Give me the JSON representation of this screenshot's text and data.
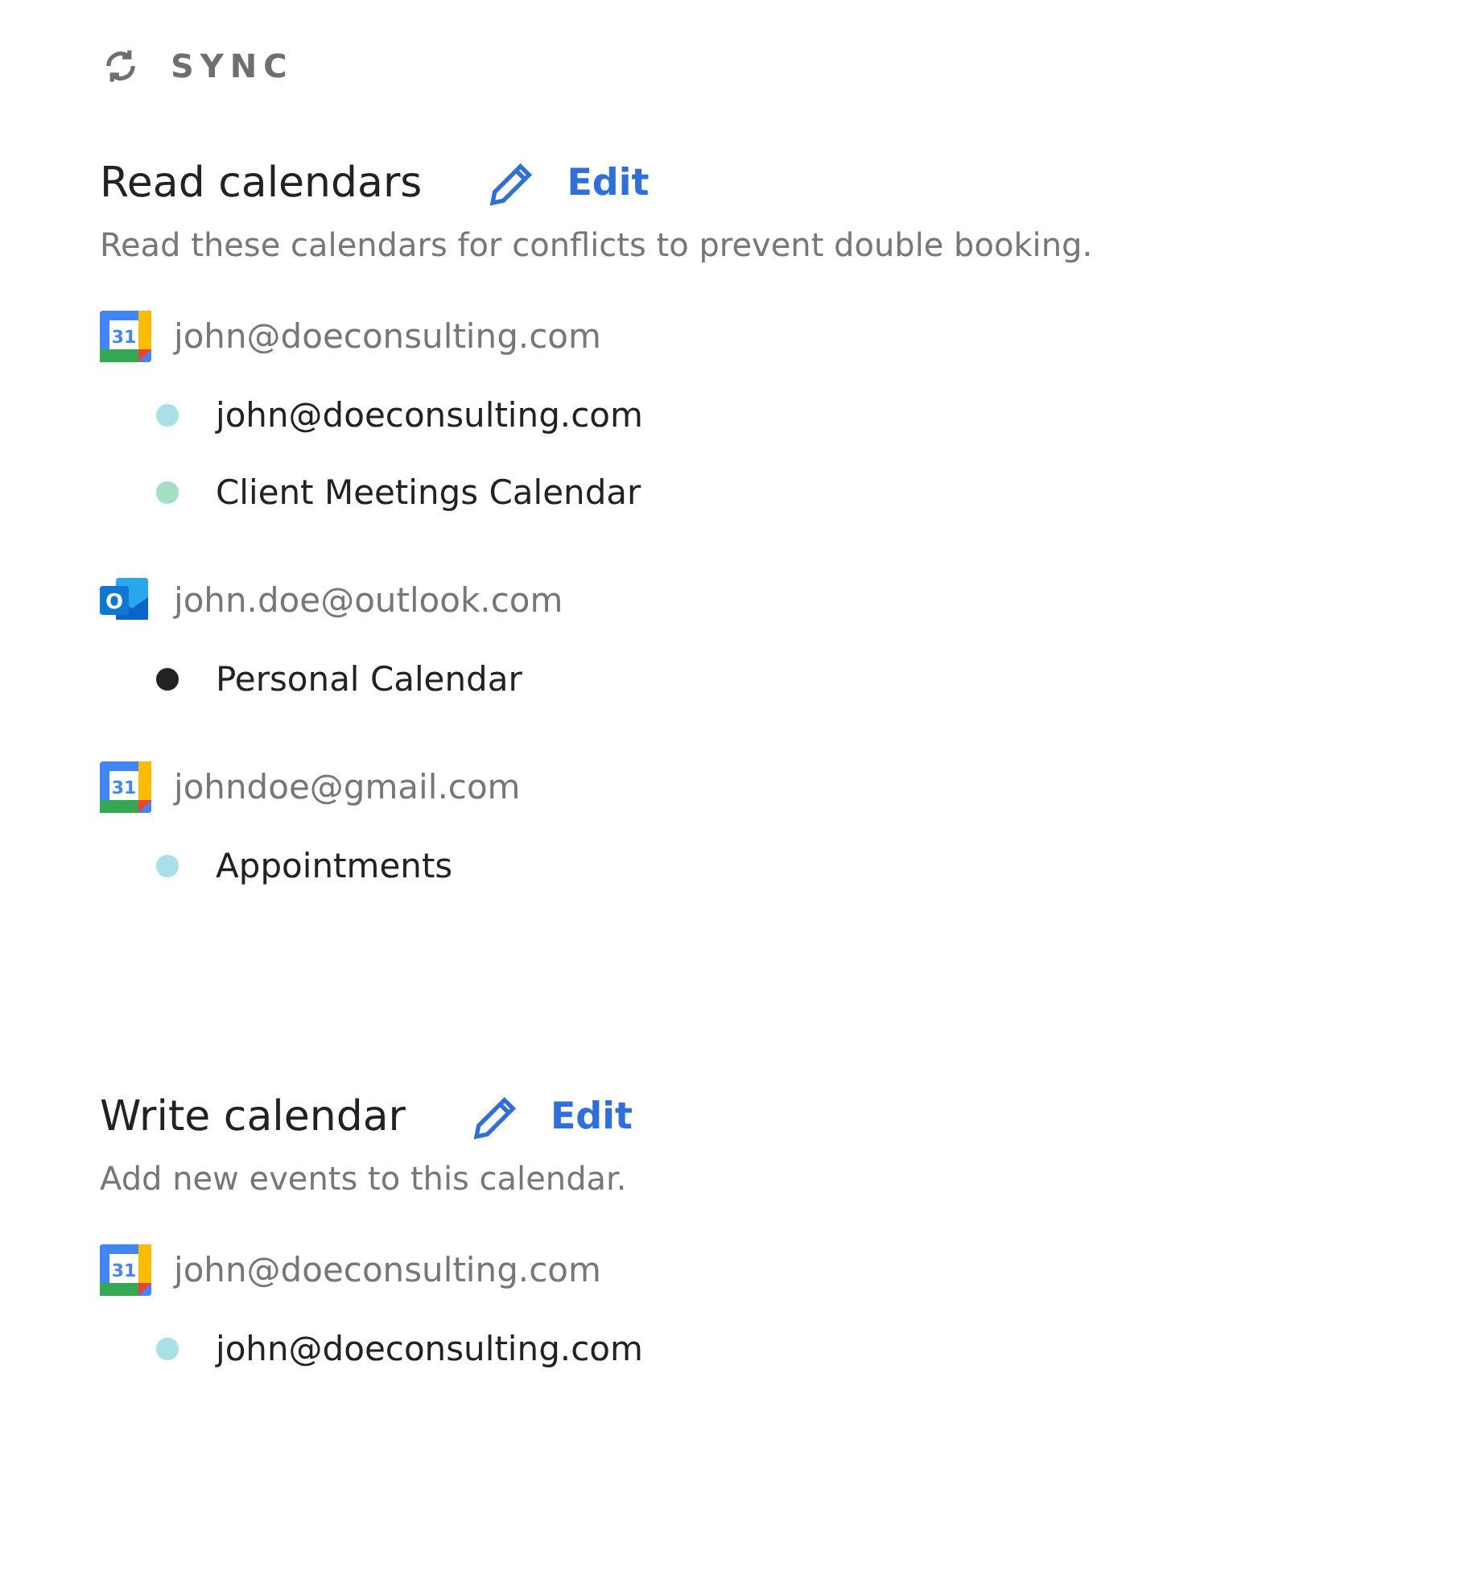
{
  "header": {
    "title": "SYNC"
  },
  "sections": [
    {
      "title": "Read calendars",
      "action": "Edit",
      "description": "Read these calendars for conflicts to prevent double booking.",
      "accounts": [
        {
          "kind": "google",
          "badge": "31",
          "email": "john@doeconsulting.com",
          "calendars": [
            {
              "name": "john@doeconsulting.com",
              "color": "#a9dfe6"
            },
            {
              "name": "Client Meetings Calendar",
              "color": "#a3dfc4"
            }
          ]
        },
        {
          "kind": "outlook",
          "badge": "O",
          "email": "john.doe@outlook.com",
          "calendars": [
            {
              "name": "Personal Calendar",
              "color": "#222222"
            }
          ]
        },
        {
          "kind": "google",
          "badge": "31",
          "email": "johndoe@gmail.com",
          "calendars": [
            {
              "name": "Appointments",
              "color": "#a9dfe6"
            }
          ]
        }
      ]
    },
    {
      "title": "Write calendar",
      "action": "Edit",
      "description": "Add new events to this calendar.",
      "accounts": [
        {
          "kind": "google",
          "badge": "31",
          "email": "john@doeconsulting.com",
          "calendars": [
            {
              "name": "john@doeconsulting.com",
              "color": "#a9dfe6"
            }
          ]
        }
      ]
    }
  ]
}
